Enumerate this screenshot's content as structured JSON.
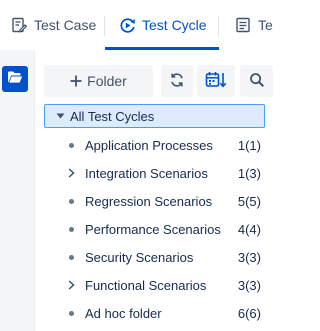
{
  "tabs": [
    {
      "label": "Test Case",
      "icon": "document-edit-icon",
      "active": false
    },
    {
      "label": "Test Cycle",
      "icon": "cycle-play-icon",
      "active": true
    },
    {
      "label": "Te",
      "icon": "document-list-icon",
      "active": false
    }
  ],
  "colors": {
    "accent": "#0052cc",
    "selected_bg": "#deebff",
    "selected_border": "#4c9aff"
  },
  "toolbar": {
    "folder_label": "Folder",
    "folder_icon": "plus-icon",
    "sync_icon": "sync-icon",
    "calendar_sort_icon": "calendar-sort-icon",
    "search_icon": "search-icon"
  },
  "tree": {
    "root": {
      "label": "All Test Cycles",
      "expanded": true
    },
    "items": [
      {
        "label": "Application Processes",
        "count": "1(1)",
        "has_children": false
      },
      {
        "label": "Integration Scenarios",
        "count": "1(3)",
        "has_children": true
      },
      {
        "label": "Regression Scenarios",
        "count": "5(5)",
        "has_children": false
      },
      {
        "label": "Performance Scenarios",
        "count": "4(4)",
        "has_children": false
      },
      {
        "label": "Security Scenarios",
        "count": "3(3)",
        "has_children": false
      },
      {
        "label": "Functional Scenarios",
        "count": "3(3)",
        "has_children": true
      },
      {
        "label": "Ad hoc folder",
        "count": "6(6)",
        "has_children": false
      }
    ]
  }
}
